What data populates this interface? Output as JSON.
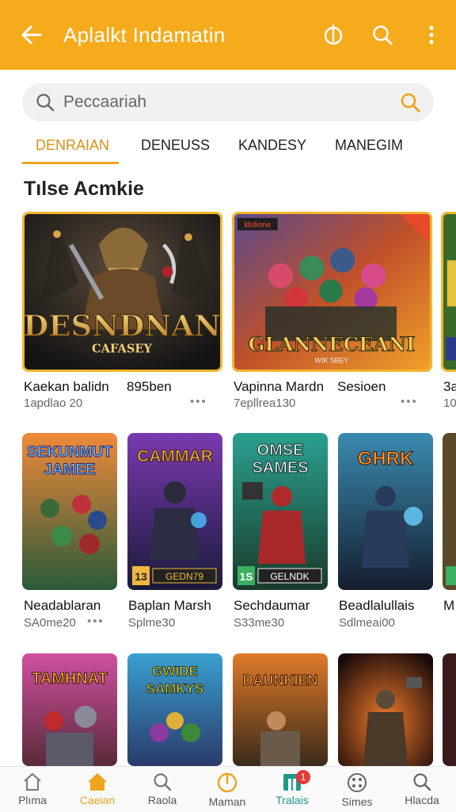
{
  "appbar": {
    "title": "Aplalkt Indamatin"
  },
  "search": {
    "placeholder": "Peccaariah"
  },
  "tabs": [
    {
      "label": "DENRAIAN",
      "active": true
    },
    {
      "label": "DENEUSS"
    },
    {
      "label": "KANDESY"
    },
    {
      "label": "MANEGIM"
    }
  ],
  "section": {
    "title": "Tılse Acmkie"
  },
  "featured": [
    {
      "art_title": "DESNDNAN",
      "art_sub": "CAFASEY",
      "name": "Kaekan balidn",
      "extra": "895ben",
      "sub": "1apdlao 20"
    },
    {
      "art_title": "GLANNECEANI",
      "art_sub": "WIK SBEY",
      "art_badge": "ldolione",
      "name": "Vapinna Mardn",
      "extra": "Sesioen",
      "sub": "7epllrea130"
    },
    {
      "name": "3a",
      "sub": "10"
    }
  ],
  "row2": [
    {
      "art_title": "SEKUNMUT JAMEE",
      "name": "Neadablaran",
      "sub": "SA0me20"
    },
    {
      "art_title": "CAMMAR",
      "art_tag": "GEDN79",
      "art_num": "13",
      "name": "Baplan Marsh",
      "sub": "Splme30"
    },
    {
      "art_title": "OMSE SAMES",
      "art_tag": "GELNDK",
      "art_num": "1S",
      "name": "Sechdaumar",
      "sub": "S33me30"
    },
    {
      "art_title": "GHRK",
      "name": "Beadlalullais",
      "sub": "Sdlmeai00"
    },
    {
      "name": "M"
    }
  ],
  "row3": [
    {
      "art_title": "TAMHNAT"
    },
    {
      "art_title": "GWIDE SAMKYS"
    },
    {
      "art_title": "DAUNKIEN"
    },
    {
      "art_title": ""
    }
  ],
  "bottomnav": [
    {
      "label": "Plıma",
      "icon": "home-icon"
    },
    {
      "label": "Caeian",
      "icon": "home-icon",
      "active": true
    },
    {
      "label": "Raola",
      "icon": "search-icon"
    },
    {
      "label": "Maman",
      "icon": "power-icon"
    },
    {
      "label": "Tralais",
      "icon": "store-icon",
      "badge": "1"
    },
    {
      "label": "Simes",
      "icon": "gamepad-icon"
    },
    {
      "label": "Hlacda",
      "icon": "search-icon"
    }
  ],
  "colors": {
    "accent": "#f5ab1c",
    "active_tab": "#d99012"
  }
}
